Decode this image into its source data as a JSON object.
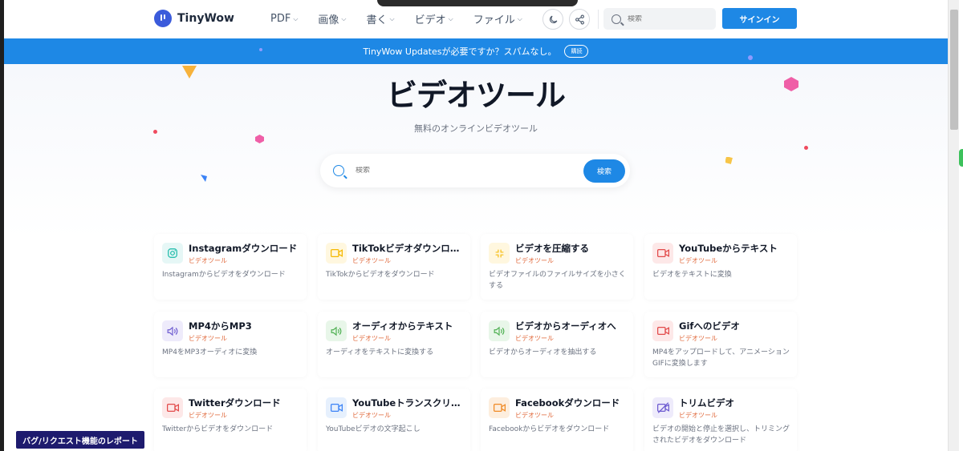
{
  "header": {
    "logo": "TinyWow",
    "nav": [
      "PDF",
      "画像",
      "書く",
      "ビデオ",
      "ファイル"
    ],
    "search_placeholder": "検索",
    "signin": "サインイン"
  },
  "banner": {
    "text": "TinyWow Updatesが必要ですか？スパムなし。",
    "button": "購読"
  },
  "hero": {
    "title": "ビデオツール",
    "subtitle": "無料のオンラインビデオツール",
    "search_placeholder": "検索",
    "search_button": "検索"
  },
  "tools": [
    {
      "title": "Instagramダウンロード",
      "category": "ビデオツール",
      "desc": "Instagramからビデオをダウンロード",
      "icon": "instagram-icon",
      "color": "#14b8a6",
      "bg": "#e6f7f6"
    },
    {
      "title": "TikTokビデオダウンロード",
      "category": "ビデオツール",
      "desc": "TikTokからビデオをダウンロード",
      "icon": "video-camera-icon",
      "color": "#f5b800",
      "bg": "#fff7df"
    },
    {
      "title": "ビデオを圧縮する",
      "category": "ビデオツール",
      "desc": "ビデオファイルのファイルサイズを小さくする",
      "icon": "compress-icon",
      "color": "#f5b800",
      "bg": "#fff7df"
    },
    {
      "title": "YouTubeからテキスト",
      "category": "ビデオツール",
      "desc": "ビデオをテキストに変換",
      "icon": "video-camera-icon",
      "color": "#e24a4a",
      "bg": "#fde8e8"
    },
    {
      "title": "MP4からMP3",
      "category": "ビデオツール",
      "desc": "MP4をMP3オーディオに変換",
      "icon": "speaker-icon",
      "color": "#6d5bd0",
      "bg": "#eeebfb"
    },
    {
      "title": "オーディオからテキスト",
      "category": "ビデオツール",
      "desc": "オーディオをテキストに変換する",
      "icon": "speaker-icon",
      "color": "#4caf50",
      "bg": "#e8f6e9"
    },
    {
      "title": "ビデオからオーディオへ",
      "category": "ビデオツール",
      "desc": "ビデオからオーディオを抽出する",
      "icon": "speaker-icon",
      "color": "#4caf50",
      "bg": "#e8f6e9"
    },
    {
      "title": "Gifへのビデオ",
      "category": "ビデオツール",
      "desc": "MP4をアップロードして、アニメーションGIFに変換します",
      "icon": "video-camera-icon",
      "color": "#e24a4a",
      "bg": "#fde8e8"
    },
    {
      "title": "Twitterダウンロード",
      "category": "ビデオツール",
      "desc": "Twitterからビデオをダウンロード",
      "icon": "video-camera-icon",
      "color": "#e24a4a",
      "bg": "#fde8e8"
    },
    {
      "title": "YouTubeトランスクリプト",
      "category": "ビデオツール",
      "desc": "YouTubeビデオの文字起こし",
      "icon": "video-camera-icon",
      "color": "#3b82f6",
      "bg": "#e6f0fd"
    },
    {
      "title": "Facebookダウンロード",
      "category": "ビデオツール",
      "desc": "Facebookからビデオをダウンロード",
      "icon": "video-camera-icon",
      "color": "#f08a24",
      "bg": "#fdeede"
    },
    {
      "title": "トリムビデオ",
      "category": "ビデオツール",
      "desc": "ビデオの開始と停止を選択し、トリミングされたビデオをダウンロード",
      "icon": "video-off-icon",
      "color": "#6d5bd0",
      "bg": "#eeebfb"
    }
  ],
  "footer": {
    "bug_report": "バグ/リクエスト機能のレポート"
  },
  "colors": {
    "accent": "#1e88e5",
    "category_text": "#e0683a"
  }
}
